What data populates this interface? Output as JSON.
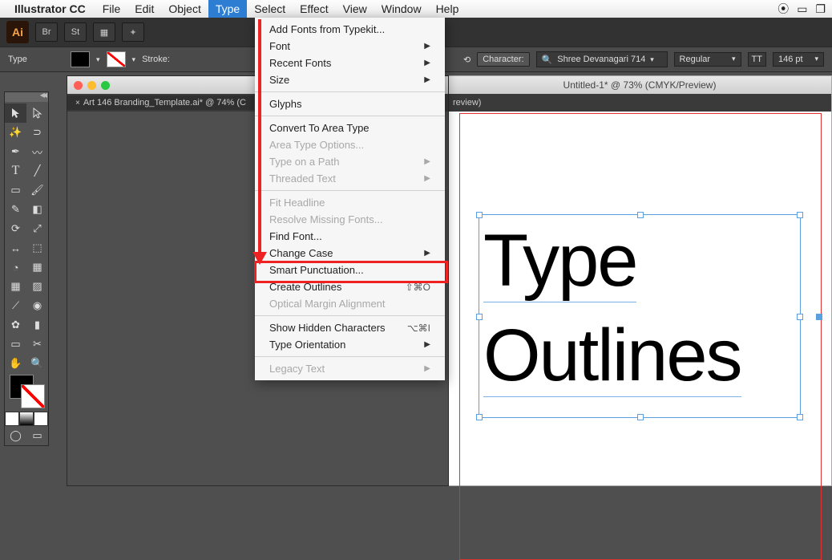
{
  "menubar": {
    "app_name": "Illustrator CC",
    "items": [
      "File",
      "Edit",
      "Object",
      "Type",
      "Select",
      "Effect",
      "View",
      "Window",
      "Help"
    ],
    "active_index": 3
  },
  "controlbar": {
    "tool_label": "Type",
    "stroke_label": "Stroke:",
    "character_label": "Character:",
    "font_name": "Shree Devanagari 714",
    "font_style": "Regular",
    "font_size": "146 pt",
    "tt_icon": "TT"
  },
  "window1": {
    "tab_title": "Art 146 Branding_Template.ai* @ 74% (C"
  },
  "window2": {
    "title": "Untitled-1* @ 73% (CMYK/Preview)",
    "tab_title": "review)",
    "canvas_text_line1": "Type",
    "canvas_text_line2": "Outlines"
  },
  "dropdown": {
    "items": [
      {
        "label": "Add Fonts from Typekit...",
        "enabled": true,
        "sub": false
      },
      {
        "label": "Font",
        "enabled": true,
        "sub": true
      },
      {
        "label": "Recent Fonts",
        "enabled": true,
        "sub": true
      },
      {
        "label": "Size",
        "enabled": true,
        "sub": true
      },
      {
        "sep": true
      },
      {
        "label": "Glyphs",
        "enabled": true,
        "sub": false
      },
      {
        "sep": true
      },
      {
        "label": "Convert To Area Type",
        "enabled": true,
        "sub": false
      },
      {
        "label": "Area Type Options...",
        "enabled": false,
        "sub": false
      },
      {
        "label": "Type on a Path",
        "enabled": false,
        "sub": true
      },
      {
        "label": "Threaded Text",
        "enabled": false,
        "sub": true
      },
      {
        "sep": true
      },
      {
        "label": "Fit Headline",
        "enabled": false,
        "sub": false
      },
      {
        "label": "Resolve Missing Fonts...",
        "enabled": false,
        "sub": false
      },
      {
        "label": "Find Font...",
        "enabled": true,
        "sub": false
      },
      {
        "label": "Change Case",
        "enabled": true,
        "sub": true
      },
      {
        "label": "Smart Punctuation...",
        "enabled": true,
        "sub": false
      },
      {
        "label": "Create Outlines",
        "enabled": true,
        "sub": false,
        "shortcut": "⇧⌘O"
      },
      {
        "label": "Optical Margin Alignment",
        "enabled": false,
        "sub": false
      },
      {
        "sep": true
      },
      {
        "label": "Show Hidden Characters",
        "enabled": true,
        "sub": false,
        "shortcut": "⌥⌘I"
      },
      {
        "label": "Type Orientation",
        "enabled": true,
        "sub": true
      },
      {
        "sep": true
      },
      {
        "label": "Legacy Text",
        "enabled": false,
        "sub": true
      }
    ]
  }
}
